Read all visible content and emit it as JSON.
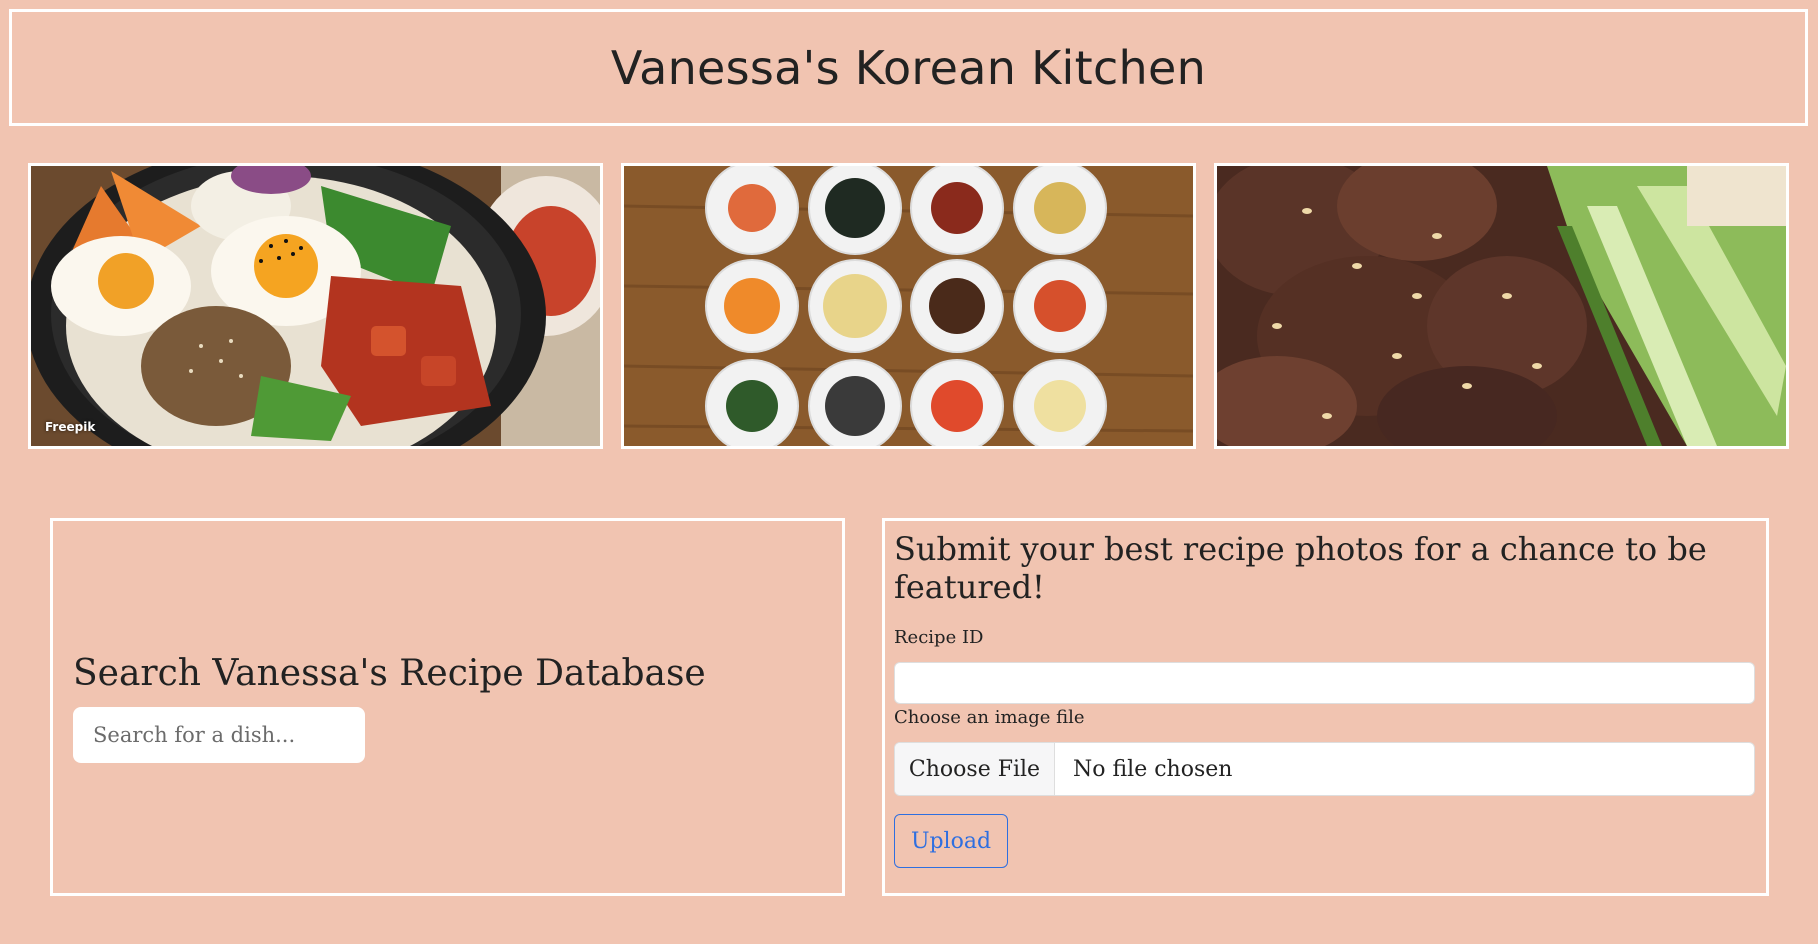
{
  "header": {
    "title": "Vanessa's Korean Kitchen"
  },
  "gallery": {
    "images": [
      {
        "subject": "bibimbap bowl",
        "credit": "Freepik"
      },
      {
        "subject": "banchan side dishes"
      },
      {
        "subject": "bulgogi with cucumber"
      }
    ]
  },
  "search": {
    "heading": "Search Vanessa's Recipe Database",
    "placeholder": "Search for a dish..."
  },
  "upload": {
    "heading": "Submit your best recipe photos for a chance to be featured!",
    "recipe_id_label": "Recipe ID",
    "image_label": "Choose an image file",
    "choose_file_label": "Choose File",
    "no_file_text": "No file chosen",
    "upload_button_label": "Upload"
  },
  "colors": {
    "background": "#f1c4b1",
    "border": "#ffffff",
    "accent": "#2f6fe0"
  }
}
